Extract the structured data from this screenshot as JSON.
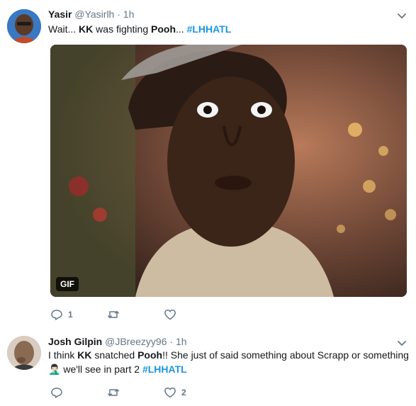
{
  "tweets": [
    {
      "name": "Yasir",
      "handle": "@Yasirlh",
      "dot": "·",
      "time": "1h",
      "text": {
        "p1": "Wait... ",
        "b1": "KK",
        "p2": " was fighting ",
        "b2": "Pooh",
        "p3": "... ",
        "hashtag": "#LHHATL"
      },
      "media_badge": "GIF",
      "reply_count": "1",
      "retweet_count": "",
      "like_count": ""
    },
    {
      "name": "Josh Gilpin",
      "handle": "@JBreezyy96",
      "dot": "·",
      "time": "1h",
      "text": {
        "p1": "I think ",
        "b1": "KK",
        "p2": " snatched ",
        "b2": "Pooh",
        "p3": "!! She just of said something about Scrapp or something",
        "emoji": "🤦🏻‍♂️",
        "p4": " we'll see in part 2 ",
        "hashtag": "#LHHATL"
      },
      "reply_count": "",
      "retweet_count": "",
      "like_count": "2"
    }
  ],
  "colors": {
    "accent": "#1b95e0",
    "muted": "#657786",
    "divider": "#e6ecf0"
  },
  "icons": [
    "reply-icon",
    "retweet-icon",
    "like-icon",
    "chevron-down-icon"
  ]
}
